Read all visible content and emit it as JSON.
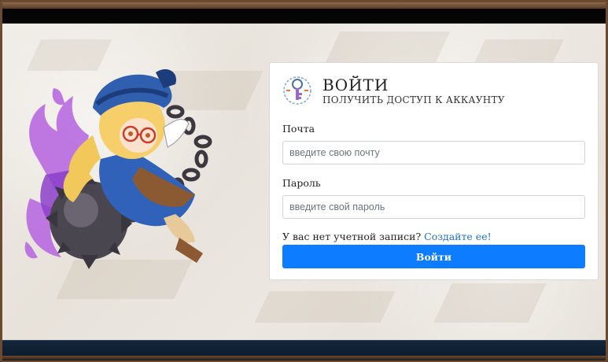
{
  "login": {
    "title": "ВОЙТИ",
    "subtitle": "ПОЛУЧИТЬ ДОСТУП К АККАУНТУ",
    "email_label": "Почта",
    "email_placeholder": "введите свою почту",
    "email_value": "",
    "password_label": "Пароль",
    "password_placeholder": "введите свой пароль",
    "password_value": "",
    "no_account_text": "У вас нет учетной записи? ",
    "signup_link": "Создайте ее!",
    "submit_label": "Войти"
  },
  "icons": {
    "login_icon": "key-icon",
    "mascot": "mascot-illustration"
  },
  "colors": {
    "primary_button": "#0d7cff",
    "link": "#1a73c8",
    "frame": "#6b4a2f",
    "bottom_bar": "#13263a"
  }
}
